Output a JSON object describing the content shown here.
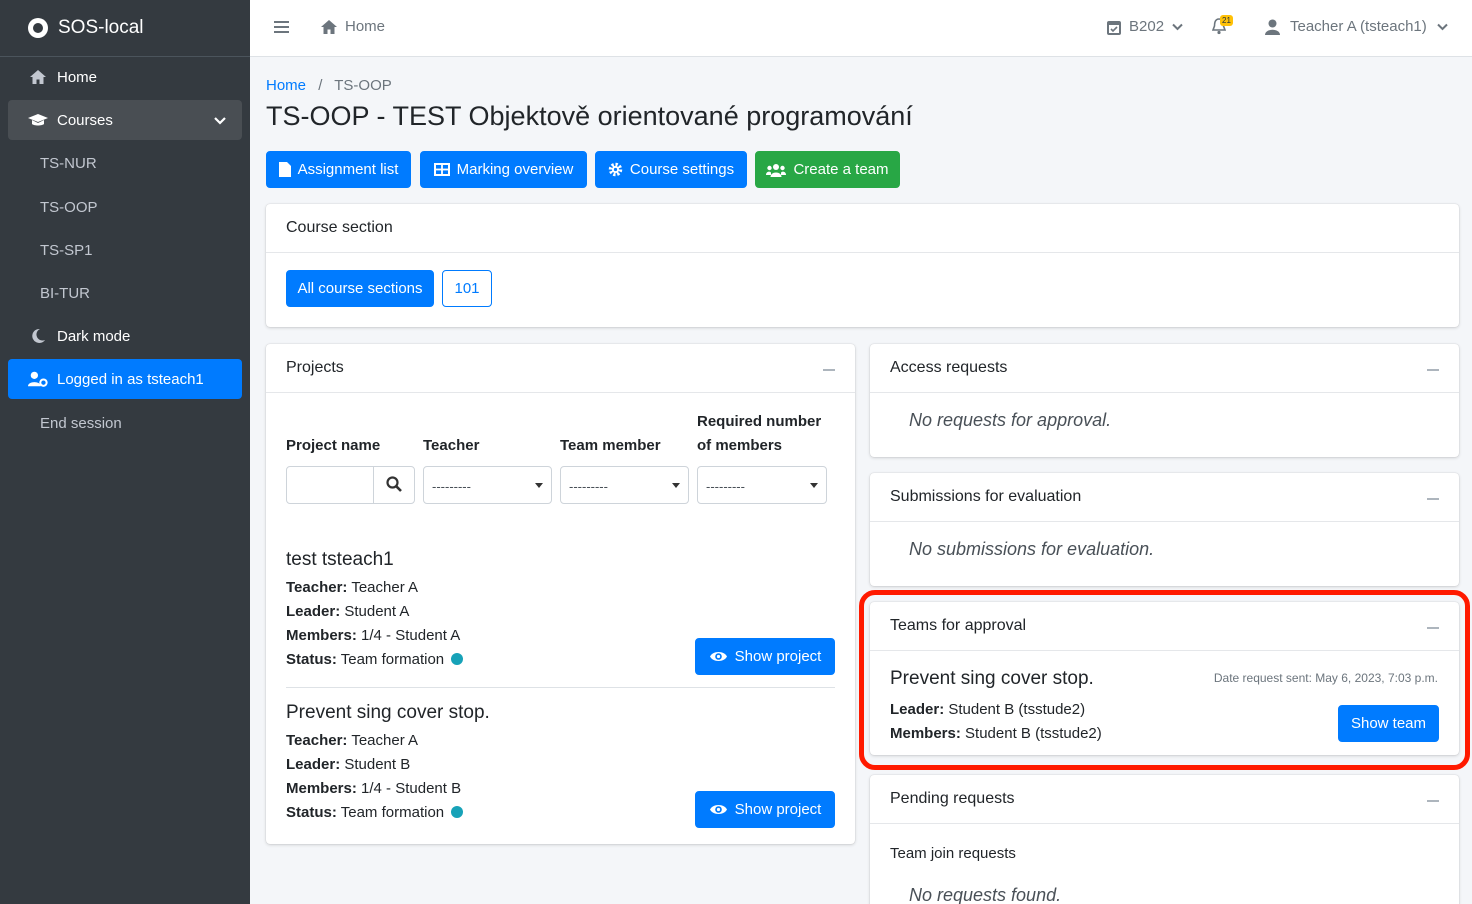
{
  "app": {
    "brand": "SOS-local"
  },
  "sidebar": {
    "items": [
      {
        "label": "Home",
        "icon": "home-icon"
      },
      {
        "label": "Courses",
        "icon": "graduation-cap-icon"
      },
      {
        "label": "TS-NUR"
      },
      {
        "label": "TS-OOP"
      },
      {
        "label": "TS-SP1"
      },
      {
        "label": "BI-TUR"
      },
      {
        "label": "Dark mode",
        "icon": "moon-icon"
      },
      {
        "label": "Logged in as tsteach1",
        "icon": "user-cog-icon"
      },
      {
        "label": "End session"
      }
    ]
  },
  "topbar": {
    "home_label": "Home",
    "room": "B202",
    "notification_count": "21",
    "user": "Teacher A (tsteach1)"
  },
  "breadcrumb": {
    "home": "Home",
    "separator": "/",
    "current": "TS-OOP"
  },
  "page_title": "TS-OOP - TEST Objektově orientované programování",
  "actions": {
    "assignment_list": "Assignment list",
    "marking_overview": "Marking overview",
    "course_settings": "Course settings",
    "create_team": "Create a team"
  },
  "course_section": {
    "title": "Course section",
    "all": "All course sections",
    "section": "101"
  },
  "projects": {
    "title": "Projects",
    "filters": {
      "project_name": "Project name",
      "teacher": "Teacher",
      "team_member": "Team member",
      "required_line1": "Required number",
      "required_line2": "of members",
      "empty_option": "---------"
    },
    "labels": {
      "teacher": "Teacher:",
      "leader": "Leader:",
      "members": "Members:",
      "status": "Status:"
    },
    "show_label": "Show project",
    "items": [
      {
        "name": "test tsteach1",
        "teacher": "Teacher A",
        "leader": "Student A",
        "members": "1/4 - Student A",
        "status": "Team formation"
      },
      {
        "name": "Prevent sing cover stop.",
        "teacher": "Teacher A",
        "leader": "Student B",
        "members": "1/4 - Student B",
        "status": "Team formation"
      }
    ]
  },
  "access_requests": {
    "title": "Access requests",
    "empty": "No requests for approval."
  },
  "submissions": {
    "title": "Submissions for evaluation",
    "empty": "No submissions for evaluation."
  },
  "teams_approval": {
    "title": "Teams for approval",
    "team_name": "Prevent sing cover stop.",
    "date_sent": "Date request sent: May 6, 2023, 7:03 p.m.",
    "leader_label": "Leader:",
    "leader": "Student B (tsstude2)",
    "members_label": "Members:",
    "members": "Student B (tsstude2)",
    "show_team": "Show team"
  },
  "pending": {
    "title": "Pending requests",
    "subtitle": "Team join requests",
    "empty": "No requests found."
  },
  "colors": {
    "primary": "#007bff",
    "success": "#28a745",
    "sidebar": "#343a40",
    "highlight": "#ff1a00",
    "status_dot": "#17a2b8"
  }
}
